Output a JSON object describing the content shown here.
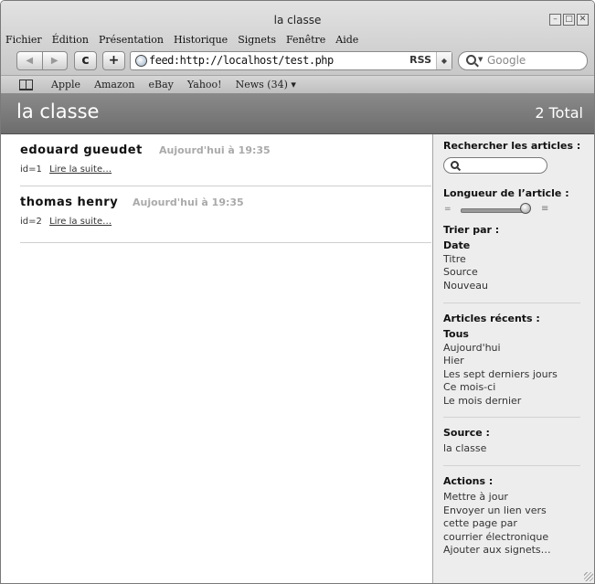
{
  "window": {
    "title": "la classe"
  },
  "menu": [
    "Fichier",
    "Édition",
    "Présentation",
    "Historique",
    "Signets",
    "Fenêtre",
    "Aide"
  ],
  "toolbar": {
    "back": "◀",
    "forward": "▶",
    "reload": "c",
    "add": "+",
    "address": "feed:http://localhost/test.php",
    "rss": "RSS",
    "search_placeholder": "Google"
  },
  "bookmarks": [
    "Apple",
    "Amazon",
    "eBay",
    "Yahoo!",
    "News (34) ▾"
  ],
  "header": {
    "title": "la classe",
    "total": "2 Total"
  },
  "articles": [
    {
      "name": "edouard gueudet",
      "date": "Aujourd'hui à  19:35",
      "id": "id=1",
      "link": "Lire la suite…"
    },
    {
      "name": "thomas henry",
      "date": "Aujourd'hui à  19:35",
      "id": "id=2",
      "link": "Lire la suite…"
    }
  ],
  "sidebar": {
    "search_heading": "Rechercher les articles :",
    "length_heading": "Longueur de l’article :",
    "article_length_level": 0.9,
    "sort_heading": "Trier par :",
    "sort_options": [
      "Date",
      "Titre",
      "Source",
      "Nouveau"
    ],
    "recent_heading": "Articles récents :",
    "recent_options": [
      "Tous",
      "Aujourd'hui",
      "Hier",
      "Les sept derniers jours",
      "Ce mois-ci",
      "Le mois dernier"
    ],
    "source_heading": "Source :",
    "source_value": "la classe",
    "actions_heading": "Actions :",
    "actions": [
      "Mettre à jour",
      "Envoyer un lien vers",
      "cette page par",
      "courrier électronique",
      "Ajouter aux signets…"
    ]
  }
}
